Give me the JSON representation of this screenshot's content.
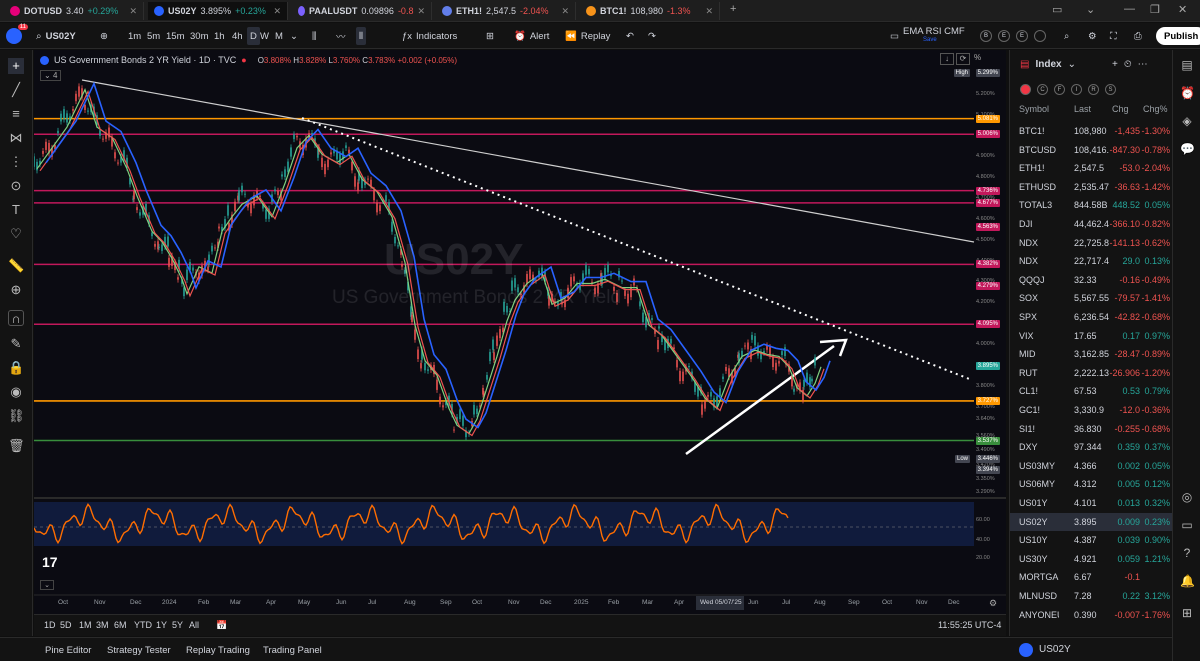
{
  "tabs": [
    {
      "symbol": "DOTUSD",
      "price": "3.40",
      "change": "+0.29%",
      "dir": "pos",
      "color": "#e6007a"
    },
    {
      "symbol": "US02Y",
      "price": "3.895%",
      "change": "+0.23%",
      "dir": "pos",
      "color": "#2962ff",
      "active": true
    },
    {
      "symbol": "PAALUSDT",
      "price": "0.09896",
      "change": "-0.8",
      "dir": "neg",
      "color": "#7b61ff"
    },
    {
      "symbol": "ETH1!",
      "price": "2,547.5",
      "change": "-2.04%",
      "dir": "neg",
      "color": "#627eea"
    },
    {
      "symbol": "BTC1!",
      "price": "108,980",
      "change": "-1.3%",
      "dir": "neg",
      "color": "#f7931a"
    }
  ],
  "toolbar": {
    "symbol": "US02Y",
    "intervals": [
      "1m",
      "5m",
      "15m",
      "30m",
      "1h",
      "4h",
      "D",
      "W",
      "M"
    ],
    "active_interval": "D",
    "indicators": "Indicators",
    "alert": "Alert",
    "replay": "Replay",
    "template": "EMA RSI CMF",
    "template_sub": "Save",
    "circle_letters": [
      "B",
      "E",
      "E"
    ],
    "publish": "Publish",
    "avatar_badge": "11"
  },
  "legend": {
    "title": "US Government Bonds 2 YR Yield · 1D · TVC",
    "o": "O",
    "o_val": "3.808%",
    "h": "H",
    "h_val": "3.828%",
    "l": "L",
    "l_val": "3.760%",
    "c": "C",
    "c_val": "3.783%",
    "chg": "+0.002 (+0.05%)",
    "count": "4"
  },
  "watermark": {
    "symbol": "US02Y",
    "name": "US Government Bonds 2 YR Yield"
  },
  "price_scale": {
    "ticks": [
      "5.300%",
      "5.200%",
      "5.100%",
      "5.000%",
      "4.900%",
      "4.800%",
      "4.700%",
      "4.600%",
      "4.500%",
      "4.400%",
      "4.300%",
      "4.200%",
      "4.100%",
      "4.000%",
      "3.900%",
      "3.800%",
      "3.700%",
      "3.640%",
      "3.560%",
      "3.490%",
      "3.420%",
      "3.350%",
      "3.290%"
    ],
    "labels": [
      {
        "text": "5.299%",
        "color": "#434651",
        "note": "High"
      },
      {
        "text": "5.081%",
        "color": "#ff9800"
      },
      {
        "text": "5.006%",
        "color": "#c2185b"
      },
      {
        "text": "4.736%",
        "color": "#c2185b"
      },
      {
        "text": "4.677%",
        "color": "#c2185b"
      },
      {
        "text": "4.563%",
        "color": "#c2185b"
      },
      {
        "text": "4.382%",
        "color": "#c2185b"
      },
      {
        "text": "4.279%",
        "color": "#c2185b"
      },
      {
        "text": "4.095%",
        "color": "#c2185b"
      },
      {
        "text": "3.895%",
        "color": "#26a69a"
      },
      {
        "text": "3.727%",
        "color": "#ff9800"
      },
      {
        "text": "3.537%",
        "color": "#388e3c"
      },
      {
        "text": "3.446%",
        "color": "#434651",
        "note": "Low"
      },
      {
        "text": "3.394%",
        "color": "#434651"
      }
    ],
    "percent": "%"
  },
  "rsi_scale": [
    "60.00",
    "40.00",
    "20.00"
  ],
  "x_axis": [
    "Oct",
    "Nov",
    "Dec",
    "2024",
    "Feb",
    "Mar",
    "Apr",
    "May",
    "Jun",
    "Jul",
    "Aug",
    "Sep",
    "Oct",
    "Nov",
    "Dec",
    "2025",
    "Feb",
    "Mar",
    "Apr",
    "Wed 05/07/'25",
    "Jun",
    "Jul",
    "Aug",
    "Sep",
    "Oct",
    "Nov",
    "Dec"
  ],
  "bottom_ranges": [
    "1D",
    "5D",
    "1M",
    "3M",
    "6M",
    "YTD",
    "1Y",
    "5Y",
    "All"
  ],
  "clock": "11:55:25 UTC-4",
  "bottom_tabs": [
    "Pine Editor",
    "Strategy Tester",
    "Replay Trading",
    "Trading Panel"
  ],
  "watchlist": {
    "title": "Index",
    "circles": [
      "C",
      "F",
      "I",
      "R",
      "S"
    ],
    "columns": [
      "Symbol",
      "Last",
      "Chg",
      "Chg%"
    ],
    "rows": [
      {
        "sym": "BTC1!",
        "last": "108,980",
        "chg": "-1,435",
        "chgp": "-1.30%",
        "dir": "neg"
      },
      {
        "sym": "BTCUSD",
        "last": "108,416.",
        "chg": "-847.30",
        "chgp": "-0.78%",
        "dir": "neg"
      },
      {
        "sym": "ETH1!",
        "last": "2,547.5",
        "chg": "-53.0",
        "chgp": "-2.04%",
        "dir": "neg"
      },
      {
        "sym": "ETHUSD",
        "last": "2,535.47",
        "chg": "-36.63",
        "chgp": "-1.42%",
        "dir": "neg"
      },
      {
        "sym": "TOTAL3",
        "last": "844.58B",
        "chg": "448.52",
        "chgp": "0.05%",
        "dir": "pos"
      },
      {
        "sym": "DJI",
        "last": "44,462.4",
        "chg": "-366.10",
        "chgp": "-0.82%",
        "dir": "neg"
      },
      {
        "sym": "NDX",
        "last": "22,725.8",
        "chg": "-141.13",
        "chgp": "-0.62%",
        "dir": "neg"
      },
      {
        "sym": "NDX",
        "last": "22,717.4",
        "chg": "29.0",
        "chgp": "0.13%",
        "dir": "pos"
      },
      {
        "sym": "QQQJ",
        "last": "32.33",
        "chg": "-0.16",
        "chgp": "-0.49%",
        "dir": "neg"
      },
      {
        "sym": "SOX",
        "last": "5,567.55",
        "chg": "-79.57",
        "chgp": "-1.41%",
        "dir": "neg"
      },
      {
        "sym": "SPX",
        "last": "6,236.54",
        "chg": "-42.82",
        "chgp": "-0.68%",
        "dir": "neg"
      },
      {
        "sym": "VIX",
        "last": "17.65",
        "chg": "0.17",
        "chgp": "0.97%",
        "dir": "pos"
      },
      {
        "sym": "MID",
        "last": "3,162.85",
        "chg": "-28.47",
        "chgp": "-0.89%",
        "dir": "neg"
      },
      {
        "sym": "RUT",
        "last": "2,222.13",
        "chg": "-26.906",
        "chgp": "-1.20%",
        "dir": "neg"
      },
      {
        "sym": "CL1!",
        "last": "67.53",
        "chg": "0.53",
        "chgp": "0.79%",
        "dir": "pos"
      },
      {
        "sym": "GC1!",
        "last": "3,330.9",
        "chg": "-12.0",
        "chgp": "-0.36%",
        "dir": "neg"
      },
      {
        "sym": "SI1!",
        "last": "36.830",
        "chg": "-0.255",
        "chgp": "-0.68%",
        "dir": "neg"
      },
      {
        "sym": "DXY",
        "last": "97.344",
        "chg": "0.359",
        "chgp": "0.37%",
        "dir": "pos"
      },
      {
        "sym": "US03MY",
        "last": "4.366",
        "chg": "0.002",
        "chgp": "0.05%",
        "dir": "pos"
      },
      {
        "sym": "US06MY",
        "last": "4.312",
        "chg": "0.005",
        "chgp": "0.12%",
        "dir": "pos"
      },
      {
        "sym": "US01Y",
        "last": "4.101",
        "chg": "0.013",
        "chgp": "0.32%",
        "dir": "pos"
      },
      {
        "sym": "US02Y",
        "last": "3.895",
        "chg": "0.009",
        "chgp": "0.23%",
        "dir": "pos",
        "sel": true
      },
      {
        "sym": "US10Y",
        "last": "4.387",
        "chg": "0.039",
        "chgp": "0.90%",
        "dir": "pos"
      },
      {
        "sym": "US30Y",
        "last": "4.921",
        "chg": "0.059",
        "chgp": "1.21%",
        "dir": "pos"
      },
      {
        "sym": "MORTGA",
        "last": "6.67",
        "chg": "-0.1",
        "chgp": "",
        "dir": "neg"
      },
      {
        "sym": "MLNUSD",
        "last": "7.28",
        "chg": "0.22",
        "chgp": "3.12%",
        "dir": "pos"
      },
      {
        "sym": "ANYONEU",
        "last": "0.390",
        "chg": "-0.007",
        "chgp": "-1.76%",
        "dir": "neg"
      }
    ],
    "footer": "US02Y"
  },
  "tv_logo": "17"
}
